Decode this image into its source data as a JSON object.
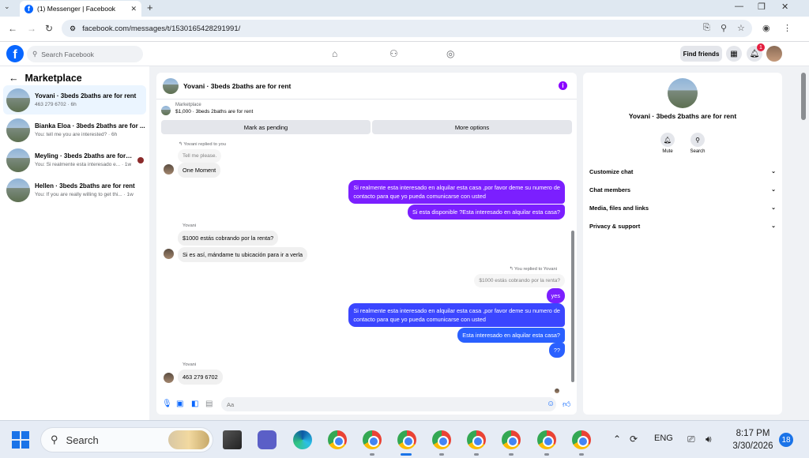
{
  "browser": {
    "tab_title": "(1) Messenger | Facebook",
    "url": "facebook.com/messages/t/1530165428291991/"
  },
  "header": {
    "search_placeholder": "Search Facebook",
    "find_friends": "Find friends",
    "notification_count": "1"
  },
  "sidebar": {
    "title": "Marketplace",
    "conversations": [
      {
        "name": "Yovani · 3beds 2baths are for rent",
        "sub": "463 279 6702 · 6h"
      },
      {
        "name": "Bianka Eloa · 3beds 2baths are for ...",
        "sub": "You: tell me you are interested? · 6h"
      },
      {
        "name": "Meyling · 3beds 2baths are for r...",
        "sub": "You: Si realmente esta interesado e... · 1w"
      },
      {
        "name": "Hellen · 3beds 2baths are for rent",
        "sub": "You: If you are really willing to get thi... · 1w"
      }
    ]
  },
  "chat": {
    "title": "Yovani · 3beds 2baths are for rent",
    "marketplace_label": "Marketplace",
    "listing": "$1,000 · 3beds 2baths are for rent",
    "mark_pending": "Mark as pending",
    "more_options": "More options",
    "input_placeholder": "Aa",
    "messages": {
      "replied_to_you": "Yovani replied to you",
      "quoted_1": "Tell me please.",
      "m1": "One Moment",
      "m2_line1": "Si realmente esta interesado en alquilar esta casa ,por favor deme su numero de",
      "m2_line2": "contacto para que yo pueda comunicarse con usted",
      "m3": "Si esta disponible ?Esta interesado en alquilar esta casa?",
      "sender1": "Yovani",
      "m4": "$1000 estás cobrando por la renta?",
      "m5": "Si es así, mándame tu ubicación para ir a verla",
      "you_replied": "You replied to Yovani",
      "quoted_2": "$1000 estás cobrando por la renta?",
      "m6": "yes",
      "m7_line1": "Si realmente esta interesado en alquilar esta casa ,por favor deme su numero de",
      "m7_line2": "contacto para que yo pueda comunicarse con usted",
      "m8": "Esta interesado en alquilar esta casa?",
      "m9": "??",
      "sender2": "Yovani",
      "m10": "463 279 6702"
    }
  },
  "right_panel": {
    "name": "Yovani · 3beds 2baths are for rent",
    "mute": "Mute",
    "search": "Search",
    "rows": [
      "Customize chat",
      "Chat members",
      "Media, files and links",
      "Privacy & support"
    ]
  },
  "taskbar": {
    "search": "Search",
    "language": "ENG",
    "time": "8:17 PM",
    "date": "3/30/2026",
    "notifications": "18"
  }
}
